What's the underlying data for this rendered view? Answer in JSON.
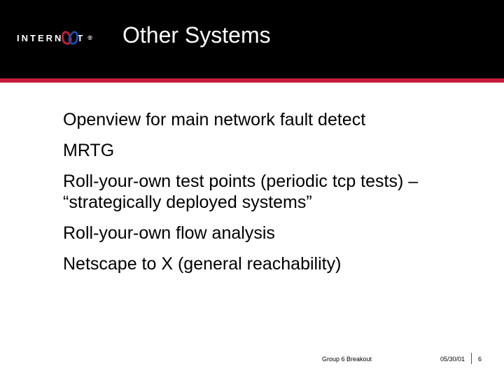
{
  "logo": {
    "prefix": "INTERN",
    "suffix": "T",
    "registered": "®"
  },
  "title": "Other Systems",
  "bullets": [
    "Openview for main network fault detect",
    "MRTG",
    "Roll-your-own test points (periodic tcp tests) – “strategically deployed systems”",
    "Roll-your-own flow analysis",
    "Netscape to X (general reachability)"
  ],
  "footer": {
    "center": "Group 6 Breakout",
    "date": "05/30/01",
    "page": "6"
  }
}
